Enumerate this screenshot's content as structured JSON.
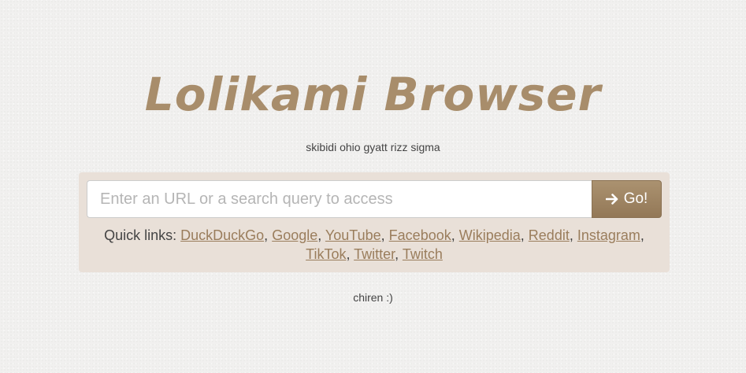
{
  "header": {
    "title": "Lolikami Browser",
    "subtitle": "skibidi ohio gyatt rizz sigma"
  },
  "search": {
    "placeholder": "Enter an URL or a search query to access",
    "value": "",
    "go_label": "Go!",
    "go_icon": "arrow-right-icon"
  },
  "quick_links": {
    "label": "Quick links:",
    "items": [
      {
        "label": "DuckDuckGo"
      },
      {
        "label": "Google"
      },
      {
        "label": "YouTube"
      },
      {
        "label": "Facebook"
      },
      {
        "label": "Wikipedia"
      },
      {
        "label": "Reddit"
      },
      {
        "label": "Instagram"
      },
      {
        "label": "TikTok"
      },
      {
        "label": "Twitter"
      },
      {
        "label": "Twitch"
      }
    ]
  },
  "footer": {
    "text": "chiren :)"
  },
  "colors": {
    "accent": "#a88d6b",
    "panel": "#e9e0d8",
    "link": "#9a7d5c",
    "button": "#a0866a"
  }
}
